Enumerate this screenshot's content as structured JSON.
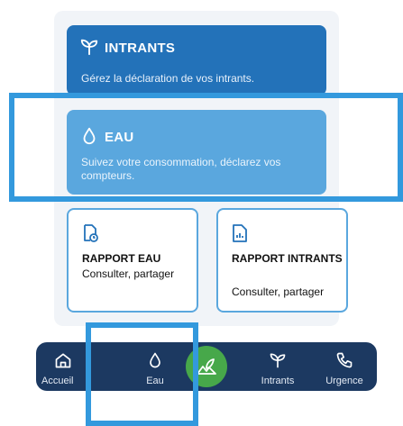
{
  "cards": {
    "intrants": {
      "title": "INTRANTS",
      "subtitle": "Gérez la déclaration de vos intrants.",
      "icon": "seedling-icon",
      "color": "#2372b9"
    },
    "eau": {
      "title": "EAU",
      "subtitle": "Suivez votre consommation, déclarez vos compteurs.",
      "icon": "water-drop-icon",
      "color": "#5aa7de"
    }
  },
  "reports": {
    "eau": {
      "title": "RAPPORT EAU",
      "subtitle": "Consulter, partager",
      "icon": "document-clock-icon"
    },
    "intrants": {
      "title": "RAPPORT INTRANTS",
      "subtitle": "Consulter, partager",
      "icon": "document-chart-icon"
    }
  },
  "nav": {
    "items": [
      {
        "label": "Accueil",
        "icon": "home-icon"
      },
      {
        "label": "Eau",
        "icon": "water-drop-icon"
      },
      {
        "label": "Intrants",
        "icon": "seedling-icon"
      },
      {
        "label": "Urgence",
        "icon": "phone-icon"
      }
    ],
    "center_icon": "field-leaf-icon",
    "background": "#1c3961",
    "center_color": "#47a84a"
  },
  "highlight_color": "#3399dd"
}
